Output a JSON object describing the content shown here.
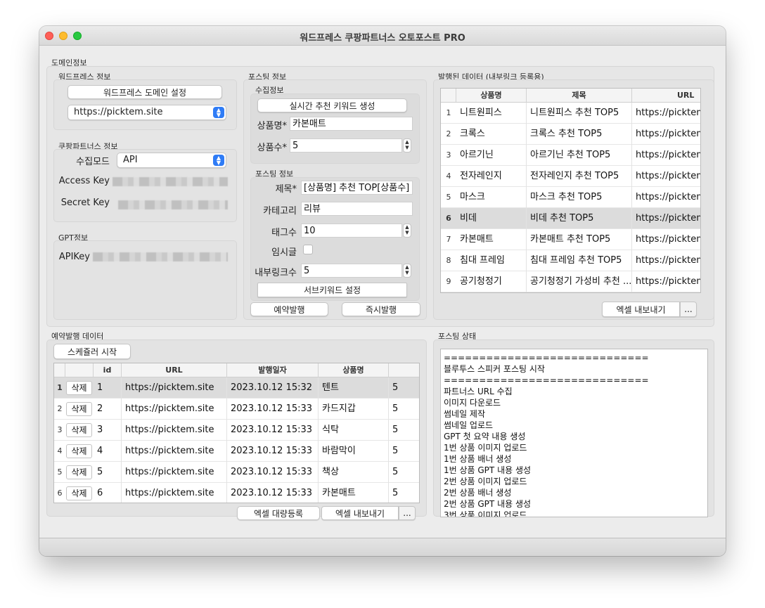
{
  "window": {
    "title": "워드프레스 쿠팡파트너스 오토포스트 PRO"
  },
  "domain_group": {
    "label": "도메인정보"
  },
  "wordpress": {
    "label": "워드프레스 정보",
    "domain_button": "워드프레스 도메인 설정",
    "domain_select": "https://picktem.site"
  },
  "coupang": {
    "label": "쿠팡파트너스 정보",
    "mode_label": "수집모드",
    "mode_value": "API",
    "access_key_label": "Access Key",
    "secret_key_label": "Secret Key"
  },
  "gpt": {
    "label": "GPT정보",
    "api_key_label": "APIKey"
  },
  "posting": {
    "label": "포스팅 정보",
    "collect": {
      "label": "수집정보",
      "keyword_button": "실시간 추천 키워드 생성",
      "product_name_label": "상품명*",
      "product_name_value": "카본매트",
      "product_count_label": "상품수*",
      "product_count_value": "5"
    },
    "post": {
      "label": "포스팅 정보",
      "title_label": "제목*",
      "title_value": "[상품명] 추천 TOP[상품수]",
      "category_label": "카테고리",
      "category_value": "리뷰",
      "tags_label": "태그수",
      "tags_value": "10",
      "draft_label": "임시글",
      "links_label": "내부링크수",
      "links_value": "5",
      "subkeyword_button": "서브키워드 설정"
    },
    "schedule_button": "예약발행",
    "publish_now_button": "즉시발행"
  },
  "published": {
    "label": "발행된 데이터 (내부링크 등록용)",
    "columns": [
      "상품명",
      "제목",
      "URL"
    ],
    "rows": [
      {
        "num": "1",
        "product": "니트원피스",
        "title": "니트원피스 추천 TOP5",
        "url": "https://picktem."
      },
      {
        "num": "2",
        "product": "크록스",
        "title": "크록스 추천 TOP5",
        "url": "https://picktem."
      },
      {
        "num": "3",
        "product": "아르기닌",
        "title": "아르기닌 추천 TOP5",
        "url": "https://picktem."
      },
      {
        "num": "4",
        "product": "전자레인지",
        "title": "전자레인지 추천 TOP5",
        "url": "https://picktem."
      },
      {
        "num": "5",
        "product": "마스크",
        "title": "마스크 추천 TOP5",
        "url": "https://picktem."
      },
      {
        "num": "6",
        "product": "비데",
        "title": "비데 추천 TOP5",
        "url": "https://picktem."
      },
      {
        "num": "7",
        "product": "카본매트",
        "title": "카본매트 추천 TOP5",
        "url": "https://picktem."
      },
      {
        "num": "8",
        "product": "침대 프레임",
        "title": "침대 프레임 추천 TOP5",
        "url": "https://picktem."
      },
      {
        "num": "9",
        "product": "공기청정기",
        "title": "공기청정기 가성비 추천 ...",
        "url": "https://picktem."
      }
    ],
    "selected_row": 5,
    "export_button": "엑셀 내보내기",
    "more_button": "..."
  },
  "scheduled": {
    "label": "예약발행 데이터",
    "scheduler_button": "스케쥴러 시작",
    "columns": [
      "",
      "id",
      "URL",
      "발행일자",
      "상품명",
      "상"
    ],
    "rows": [
      {
        "num": "1",
        "del": "삭제",
        "id": "1",
        "url": "https://picktem.site",
        "date": "2023.10.12 15:32",
        "product": "텐트",
        "count": "5"
      },
      {
        "num": "2",
        "del": "삭제",
        "id": "2",
        "url": "https://picktem.site",
        "date": "2023.10.12 15:33",
        "product": "카드지갑",
        "count": "5"
      },
      {
        "num": "3",
        "del": "삭제",
        "id": "3",
        "url": "https://picktem.site",
        "date": "2023.10.12 15:33",
        "product": "식탁",
        "count": "5"
      },
      {
        "num": "4",
        "del": "삭제",
        "id": "4",
        "url": "https://picktem.site",
        "date": "2023.10.12 15:33",
        "product": "바람막이",
        "count": "5"
      },
      {
        "num": "5",
        "del": "삭제",
        "id": "5",
        "url": "https://picktem.site",
        "date": "2023.10.12 15:33",
        "product": "책상",
        "count": "5"
      },
      {
        "num": "6",
        "del": "삭제",
        "id": "6",
        "url": "https://picktem.site",
        "date": "2023.10.12 15:33",
        "product": "카본매트",
        "count": "5"
      }
    ],
    "selected_row": 0,
    "bulk_button": "엑셀 대량등록",
    "export_button": "엑셀 내보내기",
    "more_button": "..."
  },
  "status": {
    "label": "포스팅 상태",
    "lines": [
      "=============================",
      "블루투스 스피커 포스팅 시작",
      "=============================",
      "파트너스 URL 수집",
      "이미지 다운로드",
      "썸네일 제작",
      "썸네일 업로드",
      "GPT 첫 요약 내용 생성",
      "1번 상품 이미지 업로드",
      "1번 상품 배너 생성",
      "1번 상품 GPT 내용 생성",
      "2번 상품 이미지 업로드",
      "2번 상품 배너 생성",
      "2번 상품 GPT 내용 생성",
      "3번 상품 이미지 업로드"
    ]
  },
  "colors": {
    "select_accent": "#2f7cf6",
    "close": "#fe5f57",
    "minimize": "#febc2e",
    "maximize": "#28c840"
  }
}
